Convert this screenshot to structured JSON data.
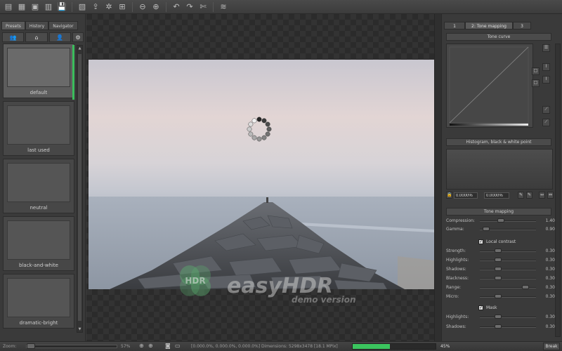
{
  "toolbar": {
    "icons": [
      "new-file-icon",
      "open-images-icon",
      "open-hdr-icon",
      "batch-icon",
      "save-icon",
      "save-as-icon",
      "export-icon",
      "settings-icon",
      "resize-icon",
      "zoom-out-icon",
      "zoom-in-icon",
      "undo-icon",
      "redo-icon",
      "crop-icon",
      "layers-icon"
    ],
    "glyphs": [
      "▤",
      "▦",
      "▣",
      "▥",
      "💾",
      "▧",
      "⇪",
      "✲",
      "⊞",
      "⊖",
      "⊕",
      "↶",
      "↷",
      "✄",
      "≋"
    ]
  },
  "left_panel": {
    "tabs": [
      "Presets",
      "History",
      "Navigator"
    ],
    "active_tab": "Presets",
    "icon_buttons": [
      "👥",
      "⌂",
      "👤",
      "⚙"
    ],
    "presets": [
      {
        "label": "default",
        "selected": true
      },
      {
        "label": "last used",
        "selected": false
      },
      {
        "label": "neutral",
        "selected": false
      },
      {
        "label": "black-and-white",
        "selected": false
      },
      {
        "label": "dramatic-bright",
        "selected": false
      }
    ]
  },
  "canvas": {
    "logo_text": "easyHDR",
    "logo_sub": "demo version",
    "logo_badge": "HDR"
  },
  "right_panel": {
    "tabs": [
      "1",
      "2: Tone mapping",
      "3"
    ],
    "active_tab": "2: Tone mapping",
    "tone_curve_title": "Tone curve",
    "histogram_title": "Histogram, black & white point",
    "black_point": "0.0000%",
    "white_point": "0.0000%",
    "tone_mapping_title": "Tone mapping",
    "compression": {
      "label": "Compression:",
      "value": "1.40",
      "level": 0.35
    },
    "gamma": {
      "label": "Gamma:",
      "value": "0.90",
      "level": 0.05
    },
    "local_contrast": {
      "label": "Local contrast",
      "checked": true
    },
    "local_params": [
      {
        "label": "Strength:",
        "value": "0.30",
        "level": 0.3
      },
      {
        "label": "Highlights:",
        "value": "0.30",
        "level": 0.3
      },
      {
        "label": "Shadows:",
        "value": "0.30",
        "level": 0.3
      },
      {
        "label": "Blackness:",
        "value": "0.30",
        "level": 0.3
      },
      {
        "label": "Range:",
        "value": "0.30",
        "level": 0.85
      },
      {
        "label": "Micro:",
        "value": "0.30",
        "level": 0.3
      }
    ],
    "mask": {
      "label": "Mask",
      "checked": true
    },
    "mask_params": [
      {
        "label": "Highlights:",
        "value": "0.30",
        "level": 0.3
      },
      {
        "label": "Shadows:",
        "value": "0.30",
        "level": 0.3
      }
    ]
  },
  "statusbar": {
    "zoom_label": "Zoom:",
    "zoom_value": "57%",
    "rgb_readout": "[0.000.0%, 0.000.0%, 0.000.0%]",
    "dimensions": "Dimensions: 5298x3478 [18.1 MPix]",
    "progress_text": "45%",
    "progress_level": 0.45,
    "break_label": "Break"
  }
}
